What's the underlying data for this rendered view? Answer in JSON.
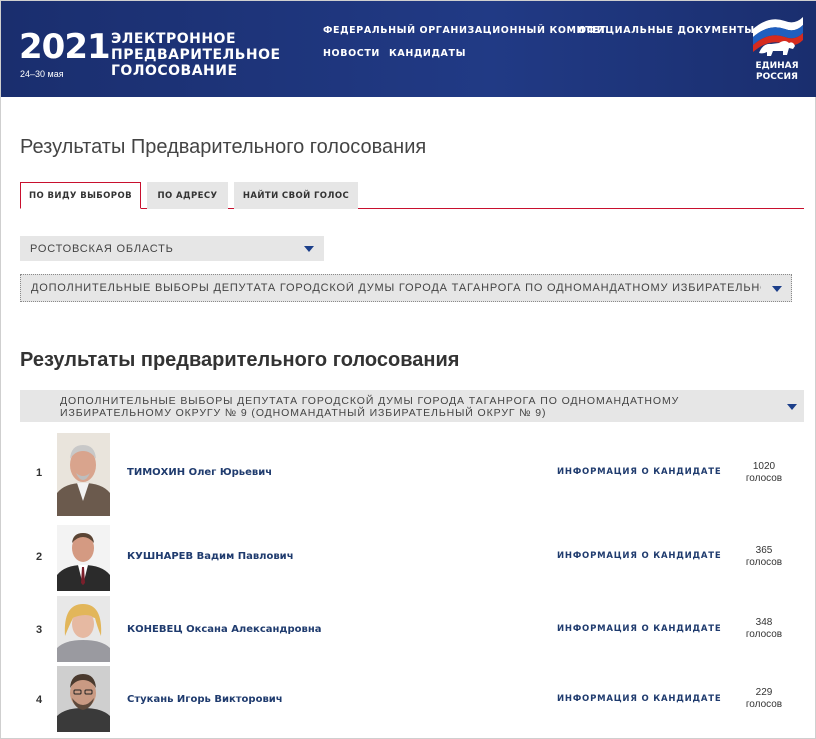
{
  "header": {
    "year": "2021",
    "dates": "24–30 мая",
    "logo_lines": [
      "ЭЛЕКТРОННОЕ",
      "ПРЕДВАРИТЕЛЬНОЕ",
      "ГОЛОСОВАНИЕ"
    ],
    "nav": [
      {
        "label": "ФЕДЕРАЛЬНЫЙ ОРГАНИЗАЦИОННЫЙ КОМИТЕТ"
      },
      {
        "label": "ОФИЦИАЛЬНЫЕ ДОКУМЕНТЫ"
      },
      {
        "label": "НОВОСТИ"
      },
      {
        "label": "КАНДИДАТЫ"
      }
    ],
    "party_logo": {
      "line1": "ЕДИНАЯ",
      "line2": "РОССИЯ",
      "icon": "bear-flag-icon"
    }
  },
  "page_title": "Результаты Предварительного голосования",
  "tabs": [
    {
      "label": "ПО ВИДУ ВЫБОРОВ",
      "active": true
    },
    {
      "label": "ПО АДРЕСУ",
      "active": false
    },
    {
      "label": "НАЙТИ СВОЙ ГОЛОС",
      "active": false
    }
  ],
  "filters": {
    "region": "РОСТОВСКАЯ ОБЛАСТЬ",
    "election": "ДОПОЛНИТЕЛЬНЫЕ ВЫБОРЫ ДЕПУТАТА ГОРОДСКОЙ ДУМЫ ГОРОДА ТАГАНРОГА ПО ОДНОМАНДАТНОМУ ИЗБИРАТЕЛЬНОМ"
  },
  "results": {
    "title": "Результаты предварительного голосования",
    "group_line1": "ДОПОЛНИТЕЛЬНЫЕ ВЫБОРЫ ДЕПУТАТА ГОРОДСКОЙ ДУМЫ ГОРОДА ТАГАНРОГА ПО ОДНОМАНДАТНОМУ",
    "group_line2": "ИЗБИРАТЕЛЬНОМУ ОКРУГУ № 9 (ОДНОМАНДАТНЫЙ ИЗБИРАТЕЛЬНЫЙ ОКРУГ № 9)",
    "info_label": "ИНФОРМАЦИЯ О КАНДИДАТЕ",
    "votes_word": "голосов",
    "candidates": [
      {
        "rank": "1",
        "name": "ТИМОХИН Олег Юрьевич",
        "votes": "1020"
      },
      {
        "rank": "2",
        "name": "КУШНАРЕВ Вадим Павлович",
        "votes": "365"
      },
      {
        "rank": "3",
        "name": "КОНЕВЕЦ Оксана Александровна",
        "votes": "348"
      },
      {
        "rank": "4",
        "name": "Стукань Игорь Викторович",
        "votes": "229"
      }
    ]
  },
  "colors": {
    "header_bg": "#1c3174",
    "accent_red": "#c8102e",
    "link_blue": "#1f3b6e",
    "select_bg": "#e6e6e6"
  }
}
